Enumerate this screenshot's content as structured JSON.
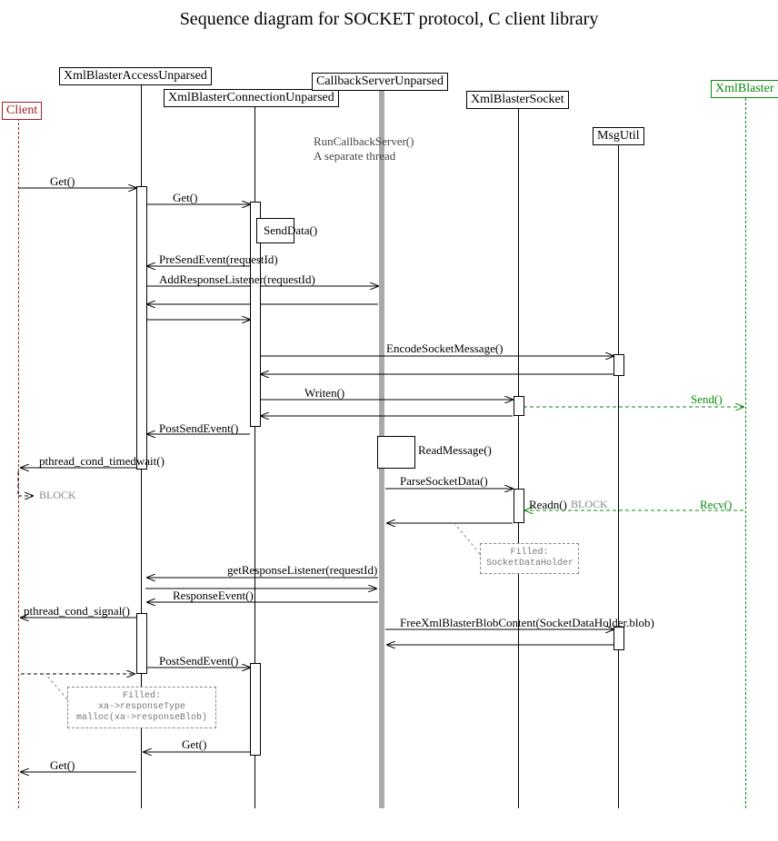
{
  "title": "Sequence diagram for SOCKET protocol, C client library",
  "participants": {
    "client": "Client",
    "xbau": "XmlBlasterAccessUnparsed",
    "xbcu": "XmlBlasterConnectionUnparsed",
    "csu": "CallbackServerUnparsed",
    "xbs": "XmlBlasterSocket",
    "msgutil": "MsgUtil",
    "server": "XmlBlaster"
  },
  "comments": {
    "runcb1": "RunCallbackServer()",
    "runcb2": "A separate thread"
  },
  "messages": {
    "get1": "Get()",
    "get2": "Get()",
    "senddata": "SendData()",
    "presend": "PreSendEvent(requestId)",
    "addresp": "AddResponseListener(requestId)",
    "encode": "EncodeSocketMessage()",
    "writen": "Writen()",
    "send": "Send()",
    "postsend1": "PostSendEvent()",
    "readmsg": "ReadMessage()",
    "pthread_wait": "pthread_cond_timedwait()",
    "parse": "ParseSocketData()",
    "readn": "Readn()",
    "recv": "Recv()",
    "getresp": "getResponseListener(requestId)",
    "resp_event": "ResponseEvent()",
    "pthread_signal": "pthread_cond_signal()",
    "free": "FreeXmlBlasterBlobContent(SocketDataHolder.blob)",
    "postsend2": "PostSendEvent()",
    "get3": "Get()",
    "get4": "Get()"
  },
  "blocks": {
    "block1": "BLOCK",
    "block2": "BLOCK"
  },
  "notes": {
    "n1a": "Filled:",
    "n1b": "SocketDataHolder",
    "n2a": "Filled:",
    "n2b": "xa->responseType",
    "n2c": "malloc(xa->responseBlob)"
  }
}
